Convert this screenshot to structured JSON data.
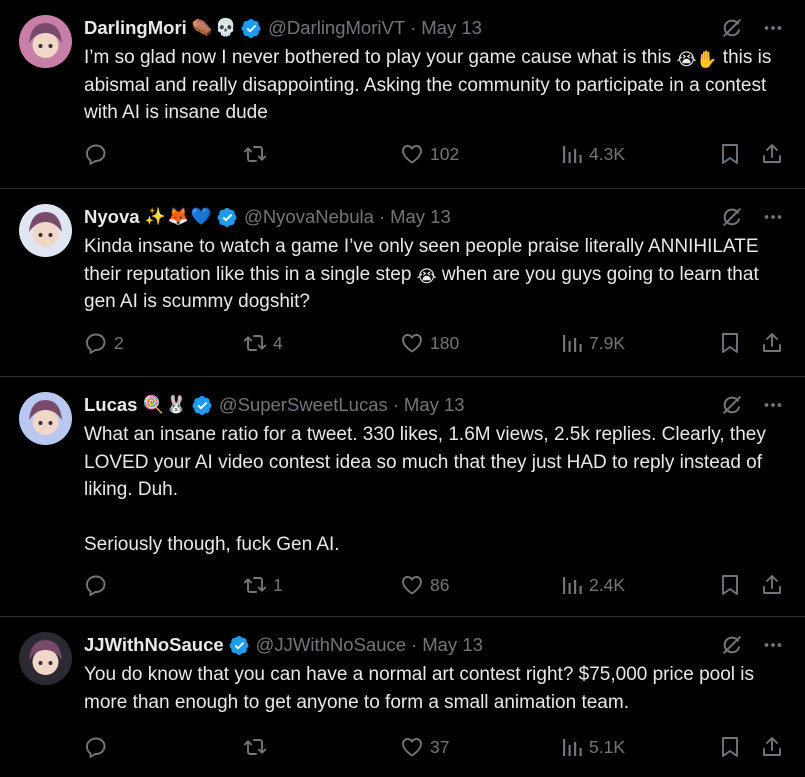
{
  "tweets": [
    {
      "name": "DarlingMori",
      "name_emojis": [
        "⚰️",
        "💀"
      ],
      "handle": "@DarlingMoriVT",
      "date": "May 13",
      "paragraphs": [
        "I’m so glad now I never bothered to play your game cause what is this 😭✋ this is abismal and really disappointing. Asking the community to participate in a contest with AI is insane dude"
      ],
      "replies": "",
      "reposts": "",
      "likes": "102",
      "views": "4.3K",
      "avatar_color": "#c77fa8"
    },
    {
      "name": "Nyova",
      "name_emojis": [
        "✨",
        "🦊",
        "💙"
      ],
      "handle": "@NyovaNebula",
      "date": "May 13",
      "paragraphs": [
        "Kinda insane to watch a game I’ve only seen people praise literally ANNIHILATE their reputation like this in a single step 😭 when are you guys going to learn that gen AI is scummy dogshit?"
      ],
      "replies": "2",
      "reposts": "4",
      "likes": "180",
      "views": "7.9K",
      "avatar_color": "#dfe6f2"
    },
    {
      "name": "Lucas",
      "name_emojis": [
        "🍭",
        "🐰"
      ],
      "handle": "@SuperSweetLucas",
      "date": "May 13",
      "paragraphs": [
        "What an insane ratio for a tweet. 330 likes, 1.6M views, 2.5k replies. Clearly, they LOVED your AI video contest idea so much that they just HAD to reply instead of liking. Duh.",
        "Seriously though, fuck Gen AI."
      ],
      "replies": "",
      "reposts": "1",
      "likes": "86",
      "views": "2.4K",
      "avatar_color": "#b8c8f0"
    },
    {
      "name": "JJWithNoSauce",
      "name_emojis": [],
      "handle": "@JJWithNoSauce",
      "date": "May 13",
      "paragraphs": [
        "You do know that you can have a normal art contest right? $75,000 price pool is more than enough to get anyone to form a small animation team."
      ],
      "replies": "",
      "reposts": "",
      "likes": "37",
      "views": "5.1K",
      "avatar_color": "#2b2a33"
    }
  ],
  "header_separator": "·",
  "icons": {
    "verified": "verified-badge-icon",
    "grok": "grok-icon",
    "more": "more-icon",
    "reply": "reply-icon",
    "repost": "repost-icon",
    "like": "like-icon",
    "views": "views-icon",
    "bookmark": "bookmark-icon",
    "share": "share-icon"
  },
  "colors": {
    "background": "#000000",
    "text": "#e7e9ea",
    "secondary": "#71767b",
    "verified": "#1d9bf0",
    "divider": "#2f3336"
  }
}
